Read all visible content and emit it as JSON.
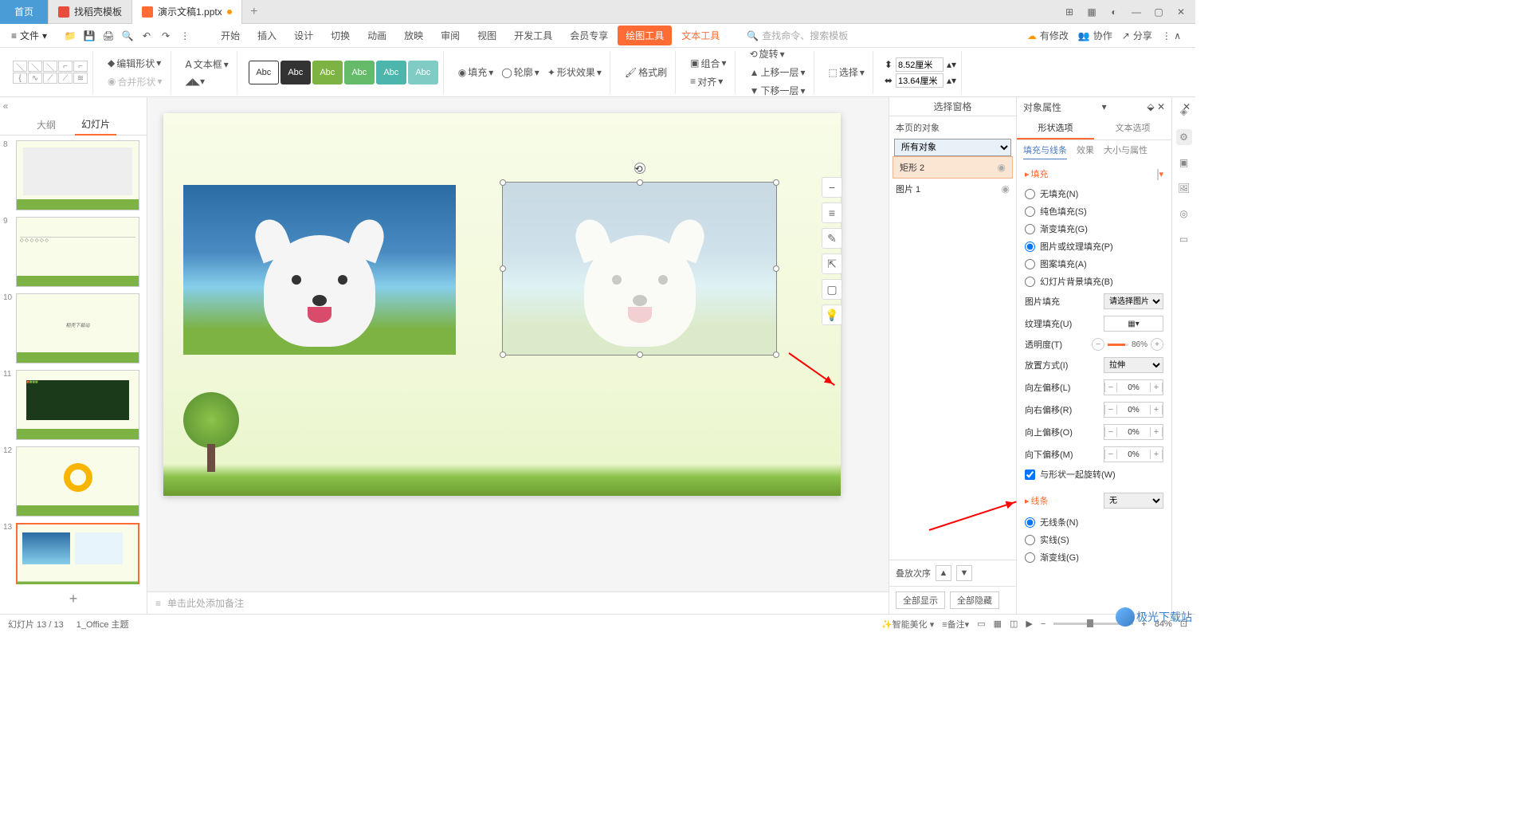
{
  "tabs": {
    "home": "首页",
    "template": "找稻壳模板",
    "doc": "演示文稿1.pptx"
  },
  "menu": {
    "file": "文件"
  },
  "ribbon": {
    "start": "开始",
    "insert": "插入",
    "design": "设计",
    "transition": "切换",
    "animation": "动画",
    "slideshow": "放映",
    "review": "审阅",
    "view": "视图",
    "developer": "开发工具",
    "member": "会员专享",
    "draw": "绘图工具",
    "text": "文本工具"
  },
  "search": {
    "placeholder": "查找命令、搜索模板"
  },
  "topRight": {
    "pending": "有修改",
    "collab": "协作",
    "share": "分享"
  },
  "toolbar": {
    "editShape": "编辑形状",
    "mergeShape": "合并形状",
    "textbox": "文本框",
    "styleLabel": "Abc",
    "fill": "填充",
    "outline": "轮廓",
    "effect": "形状效果",
    "formatPainter": "格式刷",
    "group": "组合",
    "align": "对齐",
    "rotate": "旋转",
    "bringForward": "上移一层",
    "sendBackward": "下移一层",
    "select": "选择",
    "height": "8.52厘米",
    "width": "13.64厘米"
  },
  "outline": {
    "tab1": "大纲",
    "tab2": "幻灯片",
    "slides": [
      "8",
      "9",
      "10",
      "11",
      "12",
      "13"
    ]
  },
  "notes": {
    "placeholder": "单击此处添加备注"
  },
  "selPane": {
    "title": "选择窗格",
    "objLabel": "本页的对象",
    "all": "所有对象",
    "items": [
      {
        "name": "矩形 2"
      },
      {
        "name": "图片 1"
      }
    ],
    "stackLabel": "叠放次序",
    "showAll": "全部显示",
    "hideAll": "全部隐藏"
  },
  "props": {
    "title": "对象属性",
    "tab1": "形状选项",
    "tab2": "文本选项",
    "sub1": "填充与线条",
    "sub2": "效果",
    "sub3": "大小与属性",
    "fillSection": "填充",
    "fillOpts": {
      "none": "无填充(N)",
      "solid": "纯色填充(S)",
      "gradient": "渐变填充(G)",
      "picture": "图片或纹理填充(P)",
      "pattern": "图案填充(A)",
      "slidebg": "幻灯片背景填充(B)"
    },
    "picFill": "图片填充",
    "picSel": "请选择图片",
    "texFill": "纹理填充(U)",
    "opacity": "透明度(T)",
    "opacityVal": "86%",
    "tileMode": "放置方式(I)",
    "tileVal": "拉伸",
    "offL": "向左偏移(L)",
    "offR": "向右偏移(R)",
    "offT": "向上偏移(O)",
    "offB": "向下偏移(M)",
    "offVal": "0%",
    "rotWithShape": "与形状一起旋转(W)",
    "lineSection": "线条",
    "lineNone": "无",
    "lineOpts": {
      "none": "无线条(N)",
      "solid": "实线(S)",
      "gradient": "渐变线(G)"
    }
  },
  "status": {
    "slide": "幻灯片 13 / 13",
    "theme": "1_Office 主题",
    "beautify": "智能美化",
    "notes": "备注",
    "zoom": "84%"
  },
  "watermark": "极光下载站"
}
